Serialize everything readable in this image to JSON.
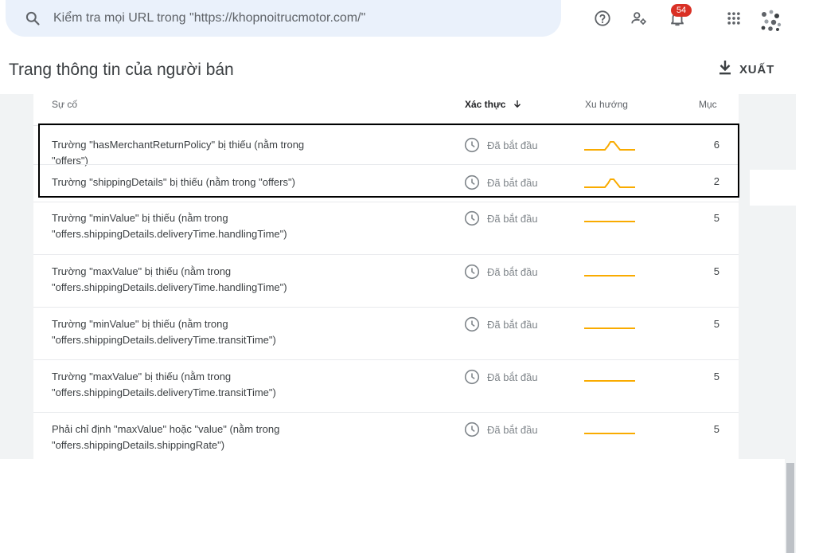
{
  "search": {
    "placeholder": "Kiểm tra mọi URL trong \"https://khopnoitrucmotor.com/\"",
    "icon": "search-icon"
  },
  "topbar": {
    "help_icon": "help-icon",
    "manage_users_icon": "manage-users-icon",
    "notifications_icon": "notifications-icon",
    "notifications_count": "54",
    "apps_icon": "apps-grid-icon",
    "avatar_icon": "account-avatar"
  },
  "header": {
    "title": "Trang thông tin của người bán",
    "export_label": "XUẤT",
    "export_icon": "download-icon"
  },
  "table": {
    "columns": {
      "issue": "Sự cố",
      "validation": "Xác thực",
      "trend": "Xu hướng",
      "items": "Mục"
    },
    "sort_icon": "arrow-down-icon",
    "status_icon": "clock-icon",
    "trend_color": "#f9ab00",
    "rows": [
      {
        "issue": "Trường \"hasMerchantReturnPolicy\" bị thiếu (nằm trong \"offers\")",
        "status": "Đã bắt đầu",
        "trend": "bump",
        "count": "6"
      },
      {
        "issue": "Trường \"shippingDetails\" bị thiếu (nằm trong \"offers\")",
        "status": "Đã bắt đầu",
        "trend": "bump",
        "count": "2"
      },
      {
        "issue": "Trường \"minValue\" bị thiếu (nằm trong \"offers.shippingDetails.deliveryTime.handlingTime\")",
        "status": "Đã bắt đầu",
        "trend": "flat",
        "count": "5"
      },
      {
        "issue": "Trường \"maxValue\" bị thiếu (nằm trong \"offers.shippingDetails.deliveryTime.handlingTime\")",
        "status": "Đã bắt đầu",
        "trend": "flat",
        "count": "5"
      },
      {
        "issue": "Trường \"minValue\" bị thiếu (nằm trong \"offers.shippingDetails.deliveryTime.transitTime\")",
        "status": "Đã bắt đầu",
        "trend": "flat",
        "count": "5"
      },
      {
        "issue": "Trường \"maxValue\" bị thiếu (nằm trong \"offers.shippingDetails.deliveryTime.transitTime\")",
        "status": "Đã bắt đầu",
        "trend": "flat",
        "count": "5"
      },
      {
        "issue": "Phải chỉ định \"maxValue\" hoặc \"value\" (nằm trong \"offers.shippingDetails.shippingRate\")",
        "status": "Đã bắt đầu",
        "trend": "flat",
        "count": "5"
      }
    ]
  }
}
